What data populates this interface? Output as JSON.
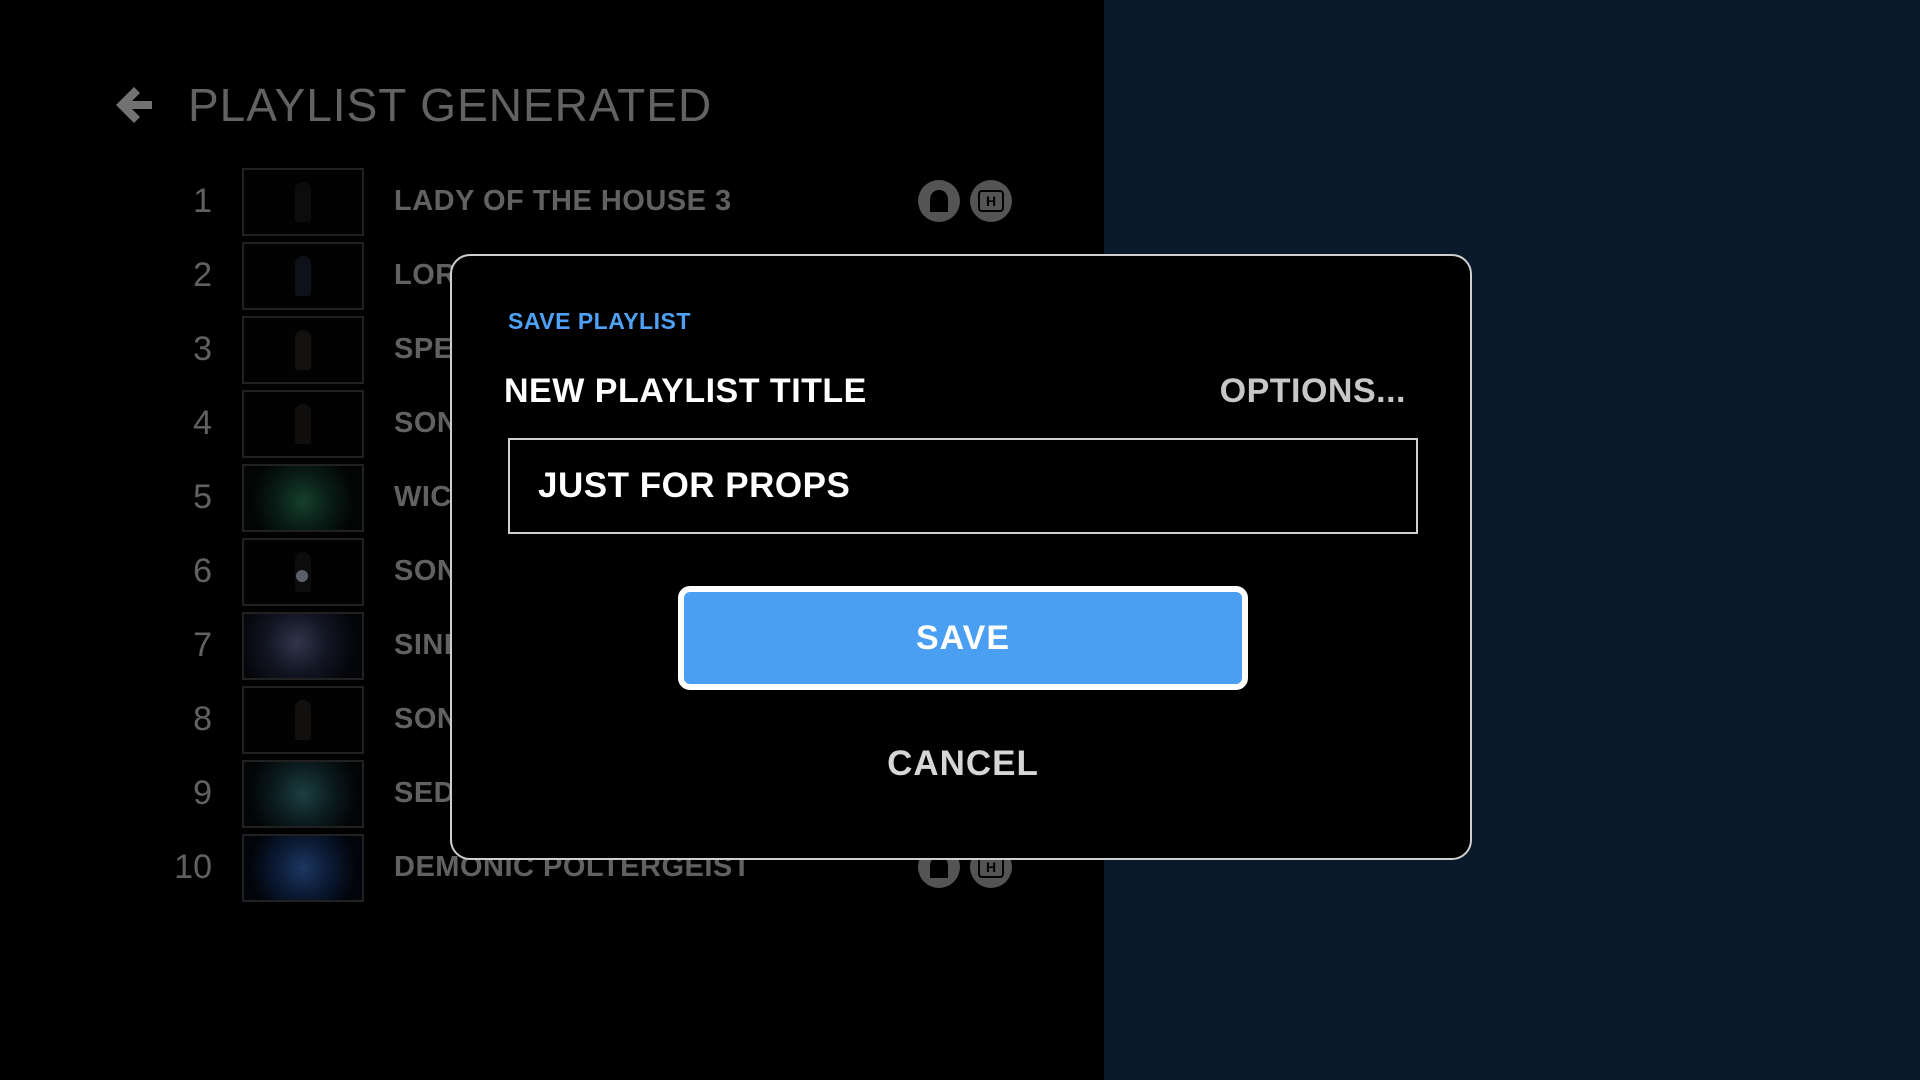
{
  "header": {
    "title": "PLAYLIST GENERATED"
  },
  "playlist": {
    "items": [
      {
        "number": "1",
        "title": "LADY OF THE HOUSE 3"
      },
      {
        "number": "2",
        "title": "LOR"
      },
      {
        "number": "3",
        "title": "SPE"
      },
      {
        "number": "4",
        "title": "SON"
      },
      {
        "number": "5",
        "title": "WIC"
      },
      {
        "number": "6",
        "title": "SON"
      },
      {
        "number": "7",
        "title": "SINI"
      },
      {
        "number": "8",
        "title": "SON"
      },
      {
        "number": "9",
        "title": "SED"
      },
      {
        "number": "10",
        "title": "DEMONIC POLTERGEIST"
      }
    ],
    "badge_letter": "H"
  },
  "dialog": {
    "label": "SAVE PLAYLIST",
    "field_label": "NEW PLAYLIST TITLE",
    "options_label": "OPTIONS...",
    "title_value": "JUST FOR PROPS",
    "save_label": "SAVE",
    "cancel_label": "CANCEL"
  },
  "colors": {
    "accent": "#4a9ff2",
    "label_blue": "#4ea1f5",
    "right_panel": "#0a1a2b"
  },
  "icons": {
    "back": "arrow-left-icon",
    "ghost_badge": "ghost-icon",
    "hd_badge": "h-badge-icon"
  }
}
